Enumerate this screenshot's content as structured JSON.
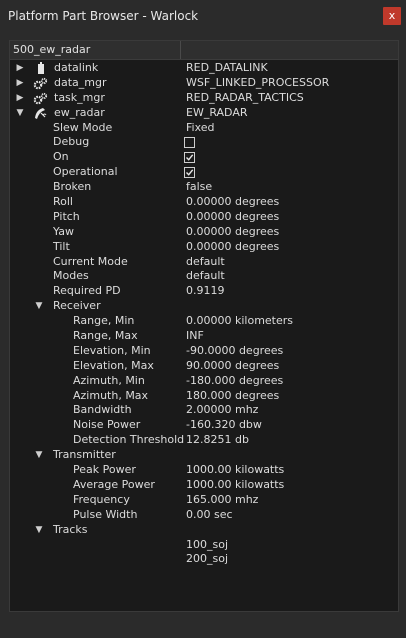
{
  "window": {
    "title": "Platform Part Browser - Warlock",
    "close_label": "x"
  },
  "header": {
    "col1": "500_ew_radar",
    "col2": ""
  },
  "tree": {
    "datalink": {
      "name": "datalink",
      "value": "RED_DATALINK"
    },
    "data_mgr": {
      "name": "data_mgr",
      "value": "WSF_LINKED_PROCESSOR"
    },
    "task_mgr": {
      "name": "task_mgr",
      "value": "RED_RADAR_TACTICS"
    },
    "ew_radar": {
      "name": "ew_radar",
      "value": "EW_RADAR"
    },
    "props": [
      {
        "name": "Slew Mode",
        "value": "Fixed"
      },
      {
        "name": "Debug",
        "checked": false
      },
      {
        "name": "On",
        "checked": true
      },
      {
        "name": "Operational",
        "checked": true
      },
      {
        "name": "Broken",
        "value": "false"
      },
      {
        "name": "Roll",
        "value": "0.00000 degrees"
      },
      {
        "name": "Pitch",
        "value": "0.00000 degrees"
      },
      {
        "name": "Yaw",
        "value": "0.00000 degrees"
      },
      {
        "name": "Tilt",
        "value": "0.00000 degrees"
      },
      {
        "name": "Current Mode",
        "value": "default"
      },
      {
        "name": "Modes",
        "value": "default"
      },
      {
        "name": "Required PD",
        "value": "0.9119"
      }
    ],
    "receiver": {
      "label": "Receiver",
      "items": [
        {
          "name": "Range, Min",
          "value": "0.00000 kilometers"
        },
        {
          "name": "Range, Max",
          "value": "INF"
        },
        {
          "name": "Elevation, Min",
          "value": "-90.0000 degrees"
        },
        {
          "name": "Elevation, Max",
          "value": "90.0000 degrees"
        },
        {
          "name": "Azimuth, Min",
          "value": "-180.000 degrees"
        },
        {
          "name": "Azimuth, Max",
          "value": "180.000 degrees"
        },
        {
          "name": "Bandwidth",
          "value": "2.00000 mhz"
        },
        {
          "name": "Noise Power",
          "value": "-160.320 dbw"
        },
        {
          "name": "Detection Threshold",
          "value": "12.8251 db"
        }
      ]
    },
    "transmitter": {
      "label": "Transmitter",
      "items": [
        {
          "name": "Peak Power",
          "value": "1000.00 kilowatts"
        },
        {
          "name": "Average Power",
          "value": "1000.00 kilowatts"
        },
        {
          "name": "Frequency",
          "value": "165.000 mhz"
        },
        {
          "name": "Pulse Width",
          "value": "0.00 sec"
        }
      ]
    },
    "tracks": {
      "label": "Tracks",
      "items": [
        "100_soj",
        "200_soj"
      ]
    }
  }
}
